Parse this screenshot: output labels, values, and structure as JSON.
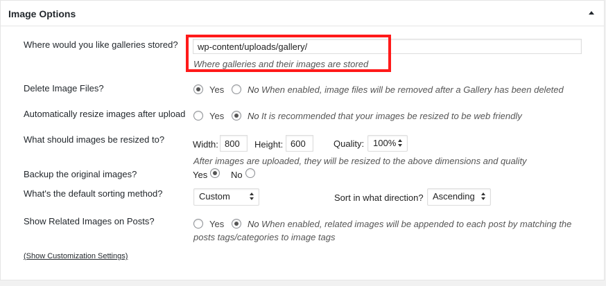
{
  "panel": {
    "title": "Image Options"
  },
  "gallery_path": {
    "label": "Where would you like galleries stored?",
    "value": "wp-content/uploads/gallery/",
    "description": "Where galleries and their images are stored"
  },
  "delete_files": {
    "label": "Delete Image Files?",
    "yes": "Yes",
    "no": "No",
    "selected": "Yes",
    "description": "When enabled, image files will be removed after a Gallery has been deleted"
  },
  "auto_resize": {
    "label": "Automatically resize images after upload",
    "yes": "Yes",
    "no": "No",
    "selected": "No",
    "description": "It is recommended that your images be resized to be web friendly"
  },
  "resize_to": {
    "label": "What should images be resized to?",
    "width_label": "Width:",
    "width_value": "800",
    "height_label": "Height:",
    "height_value": "600",
    "quality_label": "Quality:",
    "quality_value": "100%",
    "description": "After images are uploaded, they will be resized to the above dimensions and quality"
  },
  "backup": {
    "label": "Backup the original images?",
    "yes": "Yes",
    "no": "No",
    "selected": "Yes"
  },
  "sorting": {
    "label": "What's the default sorting method?",
    "method_value": "Custom",
    "direction_label": "Sort in what direction?",
    "direction_value": "Ascending"
  },
  "related": {
    "label": "Show Related Images on Posts?",
    "yes": "Yes",
    "no": "No",
    "selected": "No",
    "description_line1": "When enabled, related images will be appended to each post by matching the",
    "description_line2": "posts tags/categories to image tags"
  },
  "customization_link": "(Show Customization Settings)",
  "colors": {
    "highlight": "#ff1a1a"
  }
}
